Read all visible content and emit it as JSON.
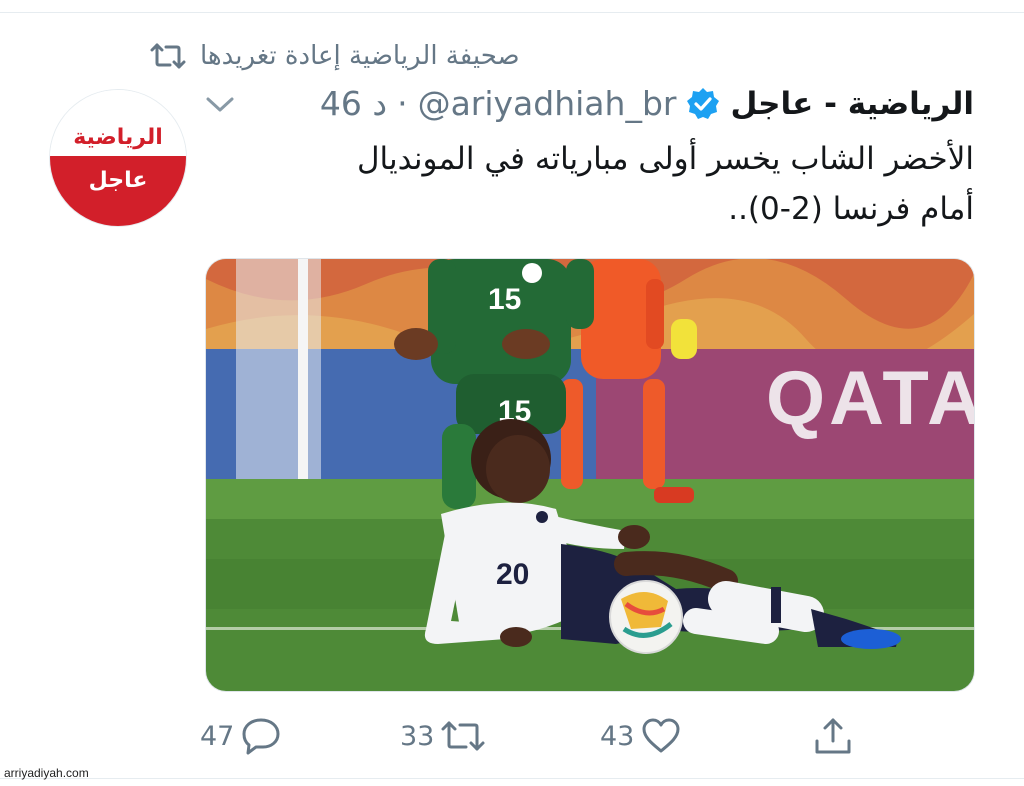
{
  "retweet_context": {
    "text": "صحيفة الرياضية إعادة تغريدها",
    "icon": "retweet-icon"
  },
  "avatar": {
    "logo_text": "الرياضية",
    "sub_text": "عاجل",
    "colors": {
      "red": "#d21f2a",
      "white": "#ffffff"
    }
  },
  "tweet": {
    "display_name": "الرياضية - عاجل",
    "verified": true,
    "handle": "@ariyadhiah_br",
    "separator": "·",
    "time": "46 د",
    "text_lines": [
      "الأخضر الشاب يخسر أولى مبارياته في المونديال",
      "أمام فرنسا (2-0).."
    ],
    "image": {
      "description_icon": "photo-soccer-match",
      "board_text": "QATAR",
      "shirt_numbers": {
        "green_player": "15",
        "white_player": "20"
      }
    }
  },
  "actions": {
    "reply_count": "47",
    "retweet_count": "33",
    "like_count": "43",
    "icons": [
      "reply-icon",
      "retweet-icon",
      "like-icon",
      "share-icon"
    ]
  },
  "watermark": "arriyadiyah.com",
  "colors": {
    "text": "#14171a",
    "secondary": "#657786",
    "verified_blue": "#1da1f2",
    "border": "#e6ecf0"
  }
}
